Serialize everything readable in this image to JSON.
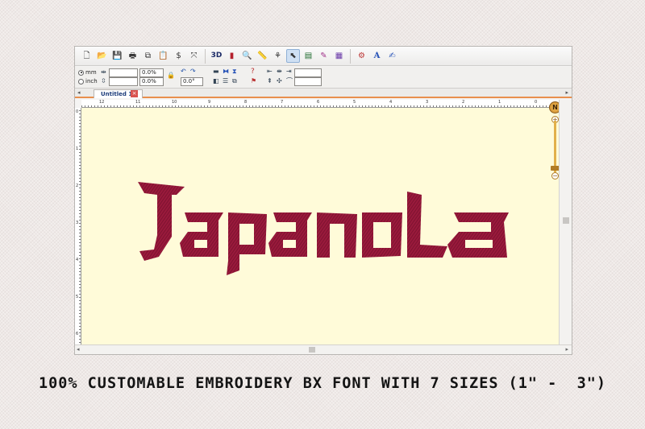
{
  "toolbar": {
    "buttons": [
      {
        "name": "new-file-icon",
        "glyph": "🗋"
      },
      {
        "name": "open-folder-icon",
        "glyph": "📂"
      },
      {
        "name": "save-icon",
        "glyph": "💾"
      },
      {
        "name": "print-icon",
        "glyph": "🖶"
      },
      {
        "name": "copy-icon",
        "glyph": "⧉"
      },
      {
        "name": "paste-icon",
        "glyph": "📋"
      },
      {
        "name": "dollar-tool-icon",
        "glyph": "$"
      },
      {
        "name": "cross-arrow-icon",
        "glyph": "⤧"
      }
    ],
    "view_buttons": [
      {
        "name": "3d-view-button",
        "glyph": "3D"
      },
      {
        "name": "color-icon",
        "glyph": "▮"
      },
      {
        "name": "zoom-icon",
        "glyph": "🔍"
      },
      {
        "name": "ruler-icon",
        "glyph": "📏"
      },
      {
        "name": "stitch-tool-icon",
        "glyph": "⚘"
      },
      {
        "name": "select-pointer-icon",
        "glyph": "⬉"
      },
      {
        "name": "layers-icon",
        "glyph": "▤"
      },
      {
        "name": "thread-icon",
        "glyph": "✎"
      },
      {
        "name": "palette-icon",
        "glyph": "▦"
      }
    ],
    "extra_buttons": [
      {
        "name": "settings-gear-icon",
        "glyph": "⚙"
      },
      {
        "name": "text-lettering-icon",
        "glyph": "A"
      },
      {
        "name": "monogram-icon",
        "glyph": "✍"
      }
    ]
  },
  "props": {
    "unit_mm": "mm",
    "unit_inch": "inch",
    "width_pct": "0.0%",
    "height_pct": "0.0%",
    "rotation": "0.0°"
  },
  "tab": {
    "title": "Untitled 1 *",
    "close_glyph": "×"
  },
  "ruler": {
    "h_labels": [
      "12",
      "11",
      "10",
      "9",
      "8",
      "7",
      "6",
      "5",
      "4",
      "3",
      "2",
      "1",
      "0"
    ],
    "v_labels": [
      "0",
      "1",
      "2",
      "3",
      "4",
      "5",
      "6"
    ]
  },
  "navigator": {
    "compass_glyph": "N",
    "zoom_in_glyph": "+",
    "zoom_out_glyph": "−"
  },
  "design": {
    "text": "Japanola",
    "thread_color": "#9a1a3c"
  },
  "caption": "100% CUSTOMABLE EMBROIDERY BX FONT WITH 7 SIZES (1\" -  3\")"
}
